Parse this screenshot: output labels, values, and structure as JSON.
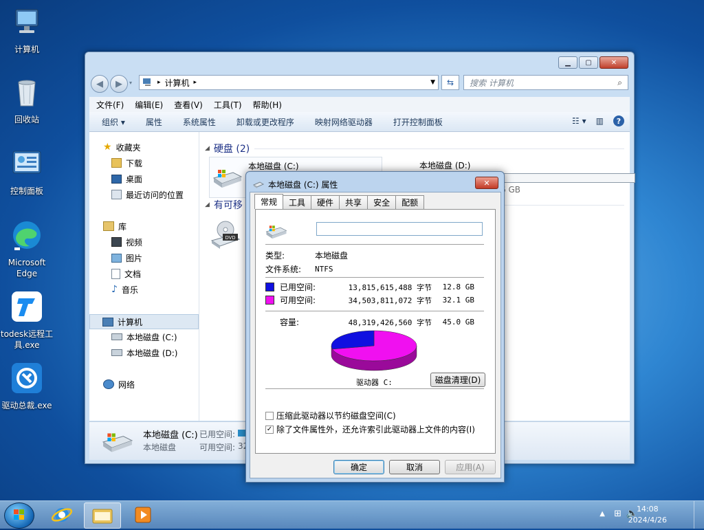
{
  "desktop": {
    "icons": [
      {
        "label": "计算机"
      },
      {
        "label": "回收站"
      },
      {
        "label": "控制面板"
      },
      {
        "label": "Microsoft Edge"
      },
      {
        "label": "todesk远程工具.exe"
      },
      {
        "label": "驱动总裁.exe"
      }
    ]
  },
  "explorer": {
    "address_path": "计算机",
    "search_placeholder": "搜索 计算机",
    "menu": [
      "文件(F)",
      "编辑(E)",
      "查看(V)",
      "工具(T)",
      "帮助(H)"
    ],
    "commands": [
      "组织 ▾",
      "属性",
      "系统属性",
      "卸载或更改程序",
      "映射网络驱动器",
      "打开控制面板"
    ],
    "nav": {
      "favorites": "收藏夹",
      "favorites_items": [
        "下载",
        "桌面",
        "最近访问的位置"
      ],
      "libraries": "库",
      "library_items": [
        "视频",
        "图片",
        "文档",
        "音乐"
      ],
      "computer": "计算机",
      "computer_items": [
        "本地磁盘 (C:)",
        "本地磁盘 (D:)"
      ],
      "network": "网络"
    },
    "groups": {
      "hdd": "硬盘 (2)",
      "removable": "有可移"
    },
    "drives": {
      "c_name": "本地磁盘 (C:)",
      "d_name": "本地磁盘 (D:)",
      "d_partial": "6 GB",
      "dvd_label": "DVD"
    },
    "status": {
      "name": "本地磁盘 (C:)",
      "type": "本地磁盘",
      "used_label": "已用空间:",
      "free_label": "可用空间:",
      "free_partial": "32"
    }
  },
  "dialog": {
    "title": "本地磁盘 (C:) 属性",
    "tabs": [
      "常规",
      "工具",
      "硬件",
      "共享",
      "安全",
      "配额"
    ],
    "label_value": "",
    "type_label": "类型:",
    "type_value": "本地磁盘",
    "fs_label": "文件系统:",
    "fs_value": "NTFS",
    "used": {
      "label": "已用空间:",
      "bytes": "13,815,615,488 字节",
      "size": "12.8 GB",
      "color": "#1010e0"
    },
    "free": {
      "label": "可用空间:",
      "bytes": "34,503,811,072 字节",
      "size": "32.1 GB",
      "color": "#f010f0"
    },
    "capacity": {
      "label": "容量:",
      "bytes": "48,319,426,560 字节",
      "size": "45.0 GB"
    },
    "drive_label": "驱动器 C:",
    "cleanup_button": "磁盘清理(D)",
    "compress_option": "压缩此驱动器以节约磁盘空间(C)",
    "compress_checked": false,
    "index_option": "除了文件属性外，还允许索引此驱动器上文件的内容(I)",
    "index_checked": true,
    "ok": "确定",
    "cancel": "取消",
    "apply": "应用(A)",
    "used_fraction": 0.286
  },
  "taskbar": {
    "time": "14:08",
    "date": "2024/4/26"
  }
}
